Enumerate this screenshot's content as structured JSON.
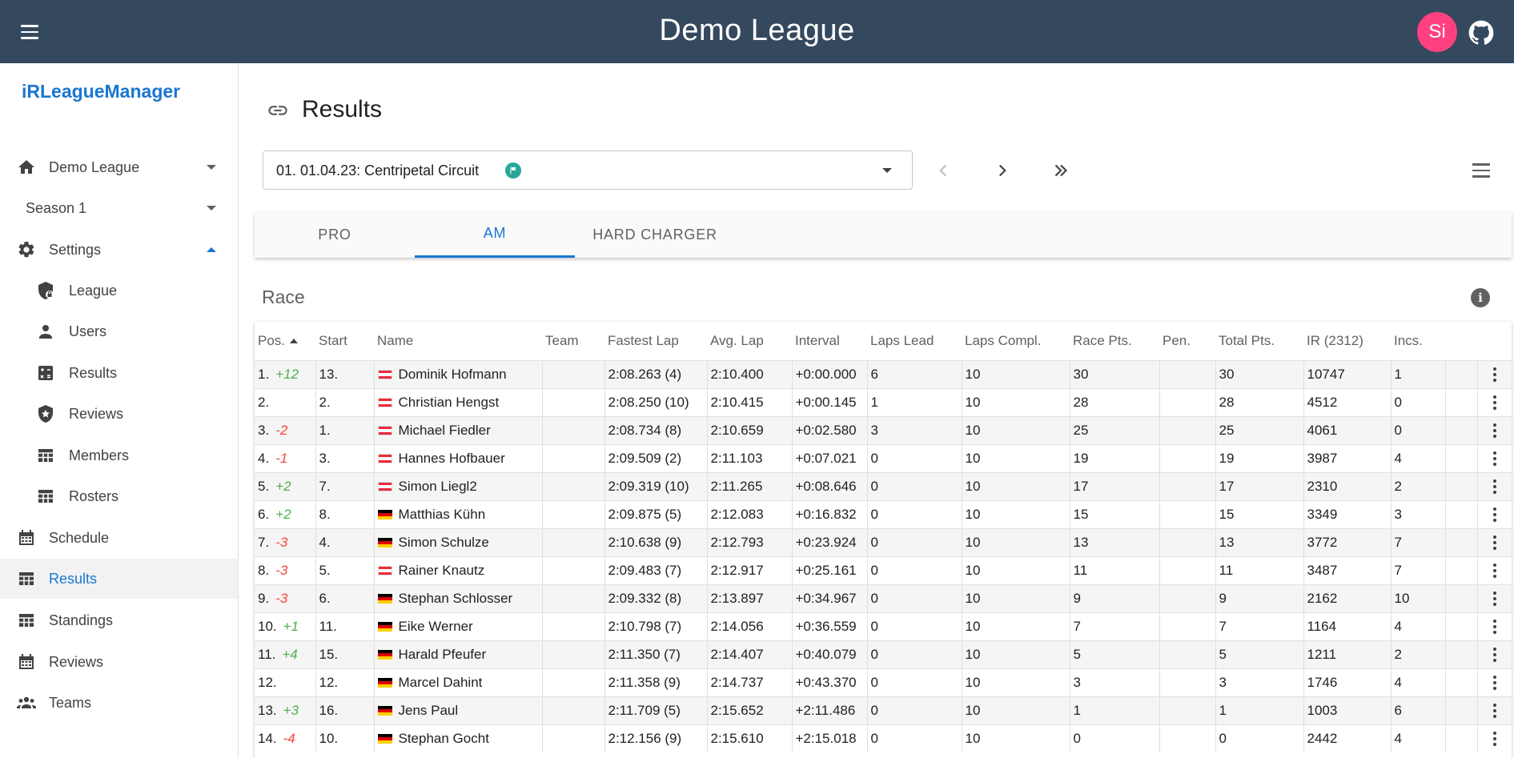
{
  "appbar": {
    "title": "Demo League",
    "avatar_initials": "Si"
  },
  "sidebar": {
    "brand": "iRLeagueManager",
    "league_select": "Demo League",
    "season_select": "Season 1",
    "settings_label": "Settings",
    "settings_items": [
      {
        "label": "League",
        "icon": "shield-lock-icon"
      },
      {
        "label": "Users",
        "icon": "person-icon"
      },
      {
        "label": "Results",
        "icon": "calculator-icon"
      },
      {
        "label": "Reviews",
        "icon": "shield-star-icon"
      },
      {
        "label": "Members",
        "icon": "table-icon"
      },
      {
        "label": "Rosters",
        "icon": "table-icon"
      }
    ],
    "main_items": [
      {
        "label": "Schedule",
        "icon": "calendar-icon"
      },
      {
        "label": "Results",
        "icon": "table-icon",
        "active": true
      },
      {
        "label": "Standings",
        "icon": "table-icon"
      },
      {
        "label": "Reviews",
        "icon": "calendar-icon"
      },
      {
        "label": "Teams",
        "icon": "group-icon"
      }
    ]
  },
  "page": {
    "title": "Results",
    "event_select": "01. 01.04.23: Centripetal Circuit",
    "tabs": [
      "PRO",
      "AM",
      "HARD CHARGER"
    ],
    "active_tab": "AM",
    "section_title": "Race"
  },
  "table": {
    "columns": [
      "Pos.",
      "Start",
      "Name",
      "Team",
      "Fastest Lap",
      "Avg. Lap",
      "Interval",
      "Laps Lead",
      "Laps Compl.",
      "Race Pts.",
      "Pen.",
      "Total Pts.",
      "IR (2312)",
      "Incs.",
      "",
      ""
    ],
    "rows": [
      {
        "pos": "1.",
        "diff": "+12",
        "start": "13.",
        "flag": "at",
        "name": "Dominik Hofmann",
        "team": "",
        "fastest": "2:08.263 (4)",
        "avg": "2:10.400",
        "interval": "+0:00.000",
        "lead": "6",
        "compl": "10",
        "race_pts": "30",
        "pen": "",
        "total": "30",
        "ir": "10747",
        "incs": "1"
      },
      {
        "pos": "2.",
        "diff": "",
        "start": "2.",
        "flag": "at",
        "name": "Christian Hengst",
        "team": "",
        "fastest": "2:08.250 (10)",
        "avg": "2:10.415",
        "interval": "+0:00.145",
        "lead": "1",
        "compl": "10",
        "race_pts": "28",
        "pen": "",
        "total": "28",
        "ir": "4512",
        "incs": "0"
      },
      {
        "pos": "3.",
        "diff": "-2",
        "start": "1.",
        "flag": "at",
        "name": "Michael Fiedler",
        "team": "",
        "fastest": "2:08.734 (8)",
        "avg": "2:10.659",
        "interval": "+0:02.580",
        "lead": "3",
        "compl": "10",
        "race_pts": "25",
        "pen": "",
        "total": "25",
        "ir": "4061",
        "incs": "0"
      },
      {
        "pos": "4.",
        "diff": "-1",
        "start": "3.",
        "flag": "at",
        "name": "Hannes Hofbauer",
        "team": "",
        "fastest": "2:09.509 (2)",
        "avg": "2:11.103",
        "interval": "+0:07.021",
        "lead": "0",
        "compl": "10",
        "race_pts": "19",
        "pen": "",
        "total": "19",
        "ir": "3987",
        "incs": "4"
      },
      {
        "pos": "5.",
        "diff": "+2",
        "start": "7.",
        "flag": "at",
        "name": "Simon Liegl2",
        "team": "",
        "fastest": "2:09.319 (10)",
        "avg": "2:11.265",
        "interval": "+0:08.646",
        "lead": "0",
        "compl": "10",
        "race_pts": "17",
        "pen": "",
        "total": "17",
        "ir": "2310",
        "incs": "2"
      },
      {
        "pos": "6.",
        "diff": "+2",
        "start": "8.",
        "flag": "de",
        "name": "Matthias Kühn",
        "team": "",
        "fastest": "2:09.875 (5)",
        "avg": "2:12.083",
        "interval": "+0:16.832",
        "lead": "0",
        "compl": "10",
        "race_pts": "15",
        "pen": "",
        "total": "15",
        "ir": "3349",
        "incs": "3"
      },
      {
        "pos": "7.",
        "diff": "-3",
        "start": "4.",
        "flag": "de",
        "name": "Simon Schulze",
        "team": "",
        "fastest": "2:10.638 (9)",
        "avg": "2:12.793",
        "interval": "+0:23.924",
        "lead": "0",
        "compl": "10",
        "race_pts": "13",
        "pen": "",
        "total": "13",
        "ir": "3772",
        "incs": "7"
      },
      {
        "pos": "8.",
        "diff": "-3",
        "start": "5.",
        "flag": "at",
        "name": "Rainer Knautz",
        "team": "",
        "fastest": "2:09.483 (7)",
        "avg": "2:12.917",
        "interval": "+0:25.161",
        "lead": "0",
        "compl": "10",
        "race_pts": "11",
        "pen": "",
        "total": "11",
        "ir": "3487",
        "incs": "7"
      },
      {
        "pos": "9.",
        "diff": "-3",
        "start": "6.",
        "flag": "de",
        "name": "Stephan Schlosser",
        "team": "",
        "fastest": "2:09.332 (8)",
        "avg": "2:13.897",
        "interval": "+0:34.967",
        "lead": "0",
        "compl": "10",
        "race_pts": "9",
        "pen": "",
        "total": "9",
        "ir": "2162",
        "incs": "10"
      },
      {
        "pos": "10.",
        "diff": "+1",
        "start": "11.",
        "flag": "de",
        "name": "Eike Werner",
        "team": "",
        "fastest": "2:10.798 (7)",
        "avg": "2:14.056",
        "interval": "+0:36.559",
        "lead": "0",
        "compl": "10",
        "race_pts": "7",
        "pen": "",
        "total": "7",
        "ir": "1164",
        "incs": "4"
      },
      {
        "pos": "11.",
        "diff": "+4",
        "start": "15.",
        "flag": "de",
        "name": "Harald Pfeufer",
        "team": "",
        "fastest": "2:11.350 (7)",
        "avg": "2:14.407",
        "interval": "+0:40.079",
        "lead": "0",
        "compl": "10",
        "race_pts": "5",
        "pen": "",
        "total": "5",
        "ir": "1211",
        "incs": "2"
      },
      {
        "pos": "12.",
        "diff": "",
        "start": "12.",
        "flag": "de",
        "name": "Marcel Dahint",
        "team": "",
        "fastest": "2:11.358 (9)",
        "avg": "2:14.737",
        "interval": "+0:43.370",
        "lead": "0",
        "compl": "10",
        "race_pts": "3",
        "pen": "",
        "total": "3",
        "ir": "1746",
        "incs": "4"
      },
      {
        "pos": "13.",
        "diff": "+3",
        "start": "16.",
        "flag": "de",
        "name": "Jens Paul",
        "team": "",
        "fastest": "2:11.709 (5)",
        "avg": "2:15.652",
        "interval": "+2:11.486",
        "lead": "0",
        "compl": "10",
        "race_pts": "1",
        "pen": "",
        "total": "1",
        "ir": "1003",
        "incs": "6"
      },
      {
        "pos": "14.",
        "diff": "-4",
        "start": "10.",
        "flag": "de",
        "name": "Stephan Gocht",
        "team": "",
        "fastest": "2:12.156 (9)",
        "avg": "2:15.610",
        "interval": "+2:15.018",
        "lead": "0",
        "compl": "10",
        "race_pts": "0",
        "pen": "",
        "total": "0",
        "ir": "2442",
        "incs": "4"
      }
    ]
  },
  "colors": {
    "appbar": "#34495e",
    "accent": "#1976d2",
    "avatar": "#ff4081",
    "positive": "#4caf50",
    "negative": "#f44336",
    "flag_badge": "#26a69a"
  }
}
